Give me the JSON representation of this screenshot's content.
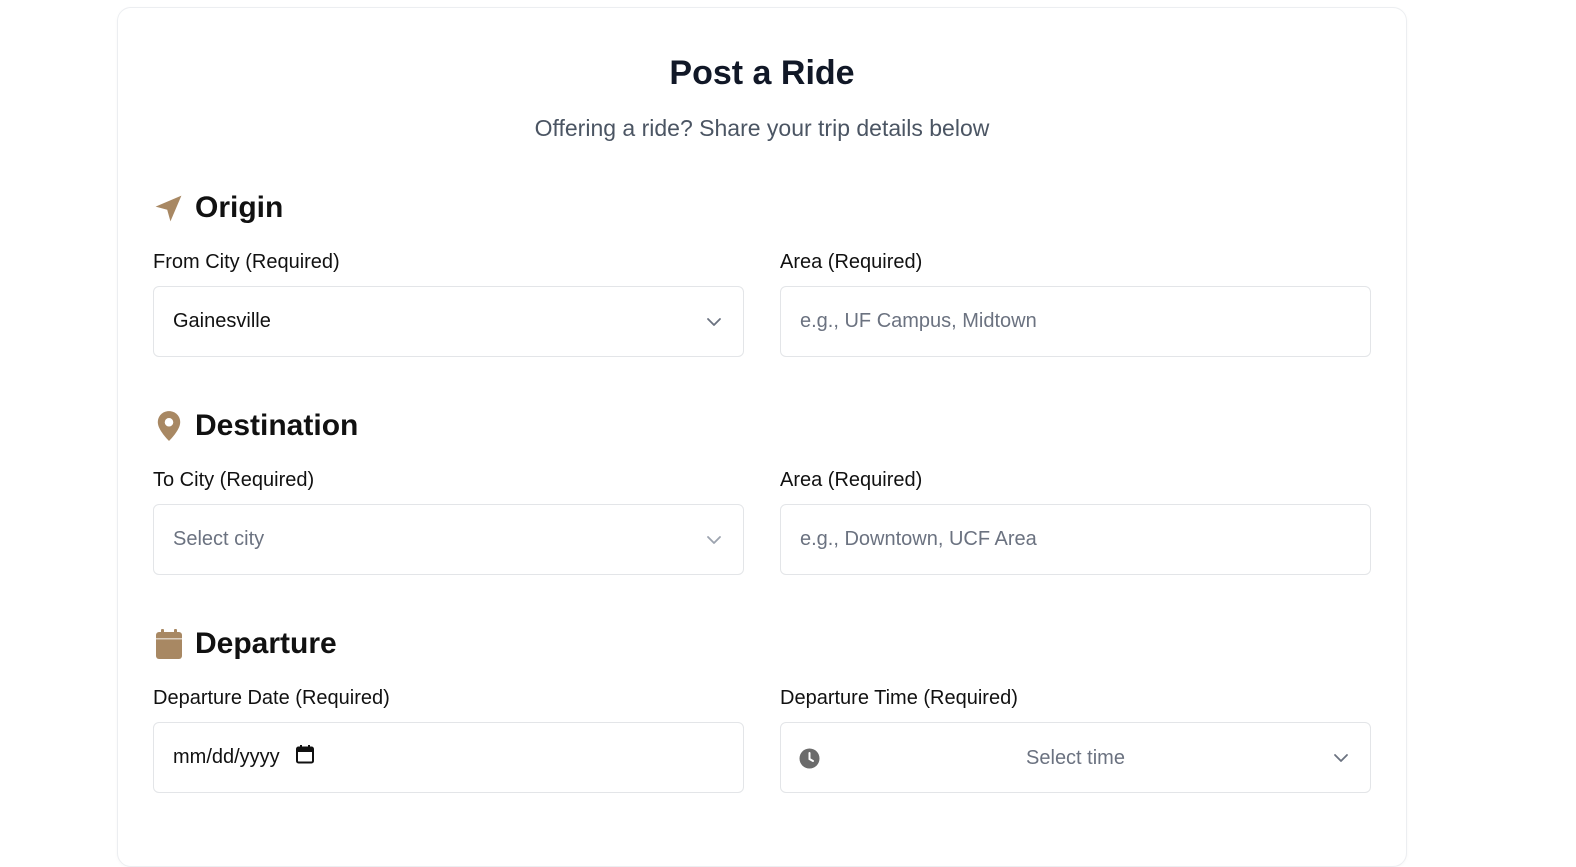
{
  "page": {
    "title": "Post a Ride",
    "subtitle": "Offering a ride? Share your trip details below"
  },
  "origin": {
    "heading": "Origin",
    "icon": "navigation-arrow-icon",
    "from_city_label": "From City (Required)",
    "from_city_value": "Gainesville",
    "area_label": "Area (Required)",
    "area_placeholder": "e.g., UF Campus, Midtown"
  },
  "destination": {
    "heading": "Destination",
    "icon": "map-pin-icon",
    "to_city_label": "To City (Required)",
    "to_city_placeholder": "Select city",
    "area_label": "Area (Required)",
    "area_placeholder": "e.g., Downtown, UCF Area"
  },
  "departure": {
    "heading": "Departure",
    "icon": "calendar-icon",
    "date_label": "Departure Date (Required)",
    "date_placeholder": "mm/dd/yyyy",
    "time_label": "Departure Time (Required)",
    "time_placeholder": "Select time"
  },
  "colors": {
    "accent": "#a88863",
    "text_primary": "#111827",
    "text_secondary": "#4b5563",
    "placeholder": "#6b7280",
    "border": "#e3e5e8"
  }
}
